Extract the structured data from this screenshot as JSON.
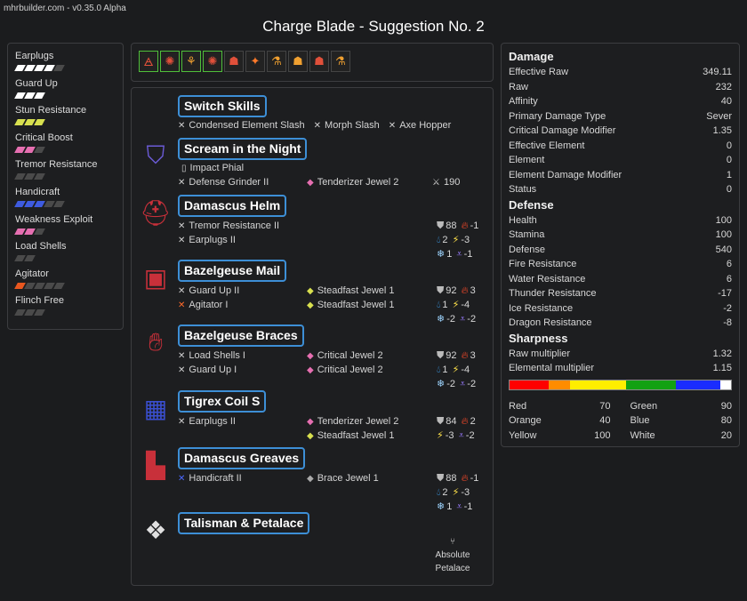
{
  "version": "mhrbuilder.com - v0.35.0 Alpha",
  "title": "Charge Blade - Suggestion No. 2",
  "colors": {
    "accent": "#3d8fd6",
    "bar_empty": "#4a4a4a"
  },
  "skills": [
    {
      "name": "Earplugs",
      "level": 4,
      "max": 5,
      "color": "#ffffff"
    },
    {
      "name": "Guard Up",
      "level": 3,
      "max": 3,
      "color": "#ffffff"
    },
    {
      "name": "Stun Resistance",
      "level": 3,
      "max": 3,
      "color": "#d8e04f"
    },
    {
      "name": "Critical Boost",
      "level": 2,
      "max": 3,
      "color": "#e66fb1"
    },
    {
      "name": "Tremor Resistance",
      "level": 0,
      "max": 3,
      "color": "#aaaaaa"
    },
    {
      "name": "Handicraft",
      "level": 3,
      "max": 5,
      "color": "#3e5be0"
    },
    {
      "name": "Weakness Exploit",
      "level": 2,
      "max": 3,
      "color": "#e66fb1"
    },
    {
      "name": "Load Shells",
      "level": 0,
      "max": 2,
      "color": "#aaaaaa"
    },
    {
      "name": "Agitator",
      "level": 1,
      "max": 5,
      "color": "#e8571f"
    },
    {
      "name": "Flinch Free",
      "level": 0,
      "max": 3,
      "color": "#aaaaaa"
    }
  ],
  "decorations": [
    {
      "icon": "jewel-red-icon",
      "glyph": "🜁",
      "selected": true
    },
    {
      "icon": "jewel-green-icon",
      "glyph": "✺",
      "selected": true
    },
    {
      "icon": "jewel-yellow-icon",
      "glyph": "⚘",
      "selected": true
    },
    {
      "icon": "jewel-green-icon",
      "glyph": "✺",
      "selected": true
    },
    {
      "icon": "jewel-red-icon",
      "glyph": "☗",
      "selected": false
    },
    {
      "icon": "jewel-sparkle-icon",
      "glyph": "✦",
      "selected": false
    },
    {
      "icon": "jewel-yellow-icon",
      "glyph": "⚗",
      "selected": false
    },
    {
      "icon": "jewel-yellow-icon",
      "glyph": "☗",
      "selected": false
    },
    {
      "icon": "jewel-red-icon",
      "glyph": "☗",
      "selected": false
    },
    {
      "icon": "jewel-yellow-icon",
      "glyph": "⚗",
      "selected": false
    }
  ],
  "equipment": {
    "switch_skills": {
      "title": "Switch Skills",
      "items": [
        "Condensed Element Slash",
        "Morph Slash",
        "Axe Hopper"
      ]
    },
    "weapon": {
      "title": "Scream in the Night",
      "phial": "Impact Phial",
      "skill": "Defense Grinder II",
      "jewel": "Tenderizer Jewel 2",
      "attack": "190"
    },
    "helm": {
      "title": "Damascus Helm",
      "skills": [
        "Tremor Resistance II",
        "Earplugs II"
      ],
      "def": "88",
      "fire": "-1",
      "water": "2",
      "thunder": "-3",
      "ice": "1",
      "dragon": "-1"
    },
    "mail": {
      "title": "Bazelgeuse Mail",
      "skills": [
        "Guard Up II",
        "Agitator I"
      ],
      "jewels": [
        "Steadfast Jewel 1",
        "Steadfast Jewel 1"
      ],
      "def": "92",
      "fire": "3",
      "water": "1",
      "thunder": "-4",
      "ice": "-2",
      "dragon": "-2"
    },
    "braces": {
      "title": "Bazelgeuse Braces",
      "skills": [
        "Load Shells I",
        "Guard Up I"
      ],
      "jewels": [
        "Critical Jewel 2",
        "Critical Jewel 2"
      ],
      "def": "92",
      "fire": "3",
      "water": "1",
      "thunder": "-4",
      "ice": "-2",
      "dragon": "-2"
    },
    "coil": {
      "title": "Tigrex Coil S",
      "skills": [
        "Earplugs II"
      ],
      "jewels": [
        "Tenderizer Jewel 2",
        "Steadfast Jewel 1"
      ],
      "def": "84",
      "fire": "2",
      "thunder": "-3",
      "dragon": "-2"
    },
    "greaves": {
      "title": "Damascus Greaves",
      "skills": [
        "Handicraft II"
      ],
      "jewels": [
        "Brace Jewel 1"
      ],
      "def": "88",
      "fire": "-1",
      "water": "2",
      "thunder": "-3",
      "ice": "1",
      "dragon": "-1"
    },
    "talisman": {
      "title": "Talisman & Petalace",
      "petalace_line1": "Absolute",
      "petalace_line2": "Petalace"
    }
  },
  "stats": {
    "damage_title": "Damage",
    "damage": [
      [
        "Effective Raw",
        "349.11"
      ],
      [
        "Raw",
        "232"
      ],
      [
        "Affinity",
        "40"
      ],
      [
        "Primary Damage Type",
        "Sever"
      ],
      [
        "Critical Damage Modifier",
        "1.35"
      ],
      [
        "Effective Element",
        "0"
      ],
      [
        "Element",
        "0"
      ],
      [
        "Element Damage Modifier",
        "1"
      ],
      [
        "Status",
        "0"
      ]
    ],
    "defense_title": "Defense",
    "defense": [
      [
        "Health",
        "100"
      ],
      [
        "Stamina",
        "100"
      ],
      [
        "Defense",
        "540"
      ],
      [
        "Fire Resistance",
        "6"
      ],
      [
        "Water Resistance",
        "6"
      ],
      [
        "Thunder Resistance",
        "-17"
      ],
      [
        "Ice Resistance",
        "-2"
      ],
      [
        "Dragon Resistance",
        "-8"
      ]
    ],
    "sharpness_title": "Sharpness",
    "sharpness_mult": [
      [
        "Raw multiplier",
        "1.32"
      ],
      [
        "Elemental multiplier",
        "1.15"
      ]
    ],
    "sharpness_values": [
      {
        "label": "Red",
        "value": 70,
        "color": "#ff0000"
      },
      {
        "label": "Orange",
        "value": 40,
        "color": "#ff8c00"
      },
      {
        "label": "Yellow",
        "value": 100,
        "color": "#ffee00"
      },
      {
        "label": "Green",
        "value": 90,
        "color": "#12a112"
      },
      {
        "label": "Blue",
        "value": 80,
        "color": "#1a2cff"
      },
      {
        "label": "White",
        "value": 20,
        "color": "#ffffff"
      }
    ],
    "sharpness_max": 400
  }
}
